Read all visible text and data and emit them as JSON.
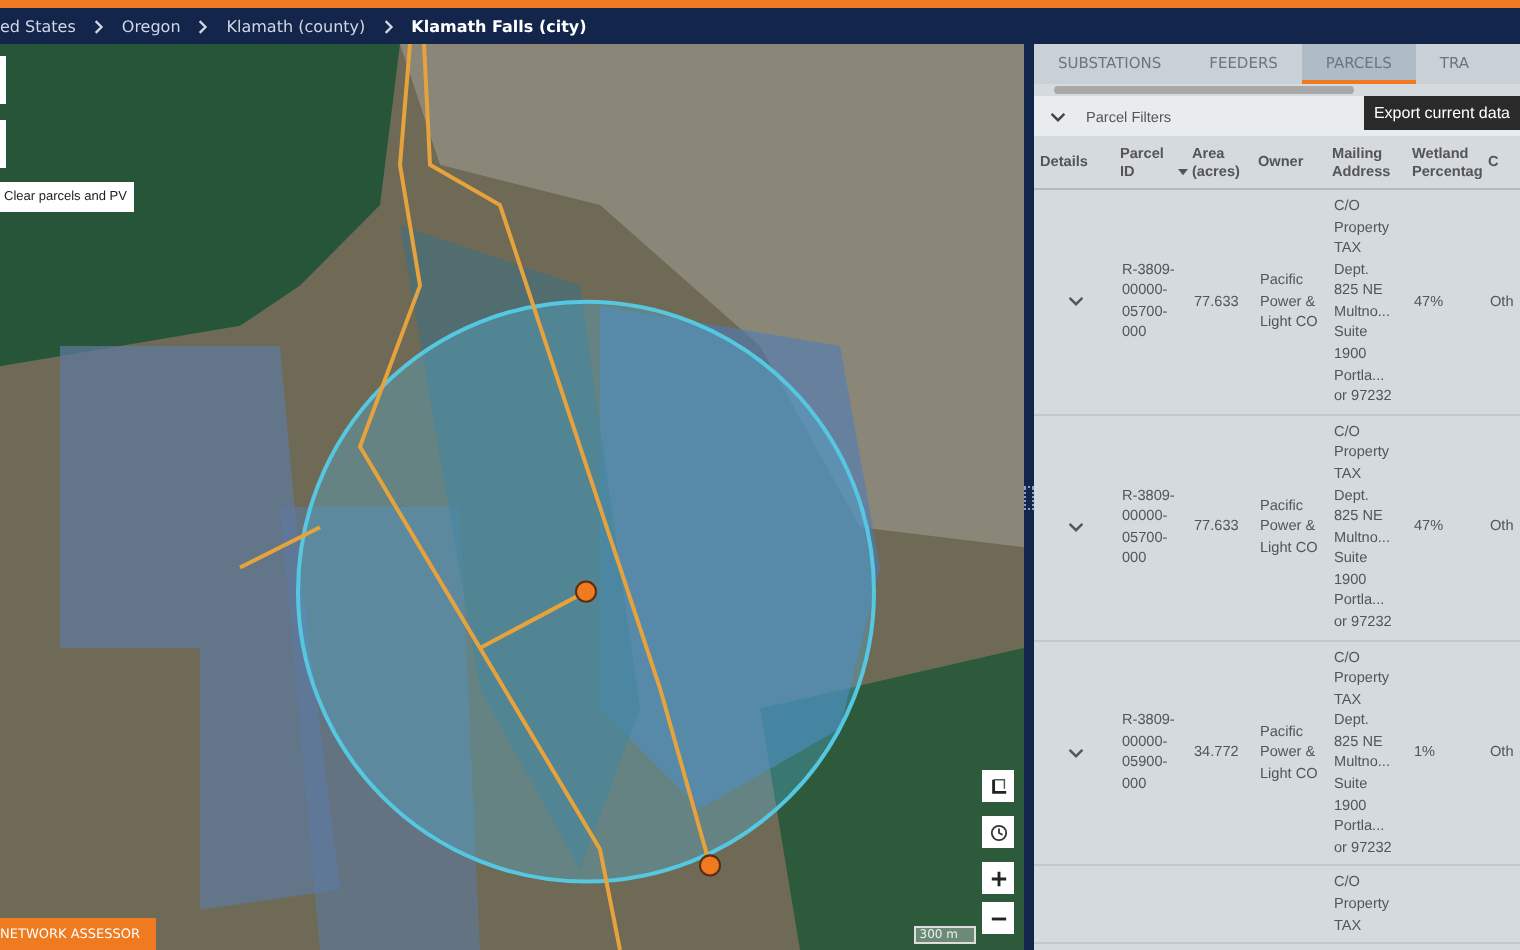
{
  "breadcrumb": [
    {
      "label": "ed States",
      "current": false
    },
    {
      "label": "Oregon",
      "current": false
    },
    {
      "label": "Klamath (county)",
      "current": false
    },
    {
      "label": "Klamath Falls (city)",
      "current": true
    }
  ],
  "map": {
    "clear_button": "Clear parcels and PV",
    "app_badge": "NETWORK ASSESSOR",
    "scale": "300 m"
  },
  "panel": {
    "tabs": [
      {
        "label": "SUBSTATIONS",
        "selected": false
      },
      {
        "label": "FEEDERS",
        "selected": false
      },
      {
        "label": "PARCELS",
        "selected": true
      },
      {
        "label": "TRA",
        "selected": false
      }
    ],
    "filters_label": "Parcel Filters",
    "tooltip": "Export current data",
    "table": {
      "columns": [
        {
          "label": "Details",
          "sort": false
        },
        {
          "label": "Parcel ID",
          "sort": true
        },
        {
          "label": "Area (acres)",
          "sort": false
        },
        {
          "label": "Owner",
          "sort": false
        },
        {
          "label": "Mailing Address",
          "sort": false
        },
        {
          "label": "Wetland Percentag",
          "sort": false
        },
        {
          "label": "C",
          "sort": false
        }
      ],
      "rows": [
        {
          "parcel_id": "R-3809-00000-05700-000",
          "area": "77.633",
          "owner": "Pacific Power & Light CO",
          "address": [
            "C/O",
            "Property",
            "TAX",
            "Dept.",
            "825 NE",
            "Multno...",
            "Suite",
            "1900",
            "Portla...",
            "or 97232"
          ],
          "wetland": "47%",
          "column_7": "Oth"
        },
        {
          "parcel_id": "R-3809-00000-05700-000",
          "area": "77.633",
          "owner": "Pacific Power & Light CO",
          "address": [
            "C/O",
            "Property",
            "TAX",
            "Dept.",
            "825 NE",
            "Multno...",
            "Suite",
            "1900",
            "Portla...",
            "or 97232"
          ],
          "wetland": "47%",
          "column_7": "Oth"
        },
        {
          "parcel_id": "R-3809-00000-05900-000",
          "area": "34.772",
          "owner": "Pacific Power & Light CO",
          "address": [
            "C/O",
            "Property",
            "TAX",
            "Dept.",
            "825 NE",
            "Multno...",
            "Suite",
            "1900",
            "Portla...",
            "or 97232"
          ],
          "wetland": "1%",
          "column_7": "Oth"
        },
        {
          "address": [
            "C/O",
            "Property",
            "TAX"
          ]
        }
      ]
    }
  }
}
